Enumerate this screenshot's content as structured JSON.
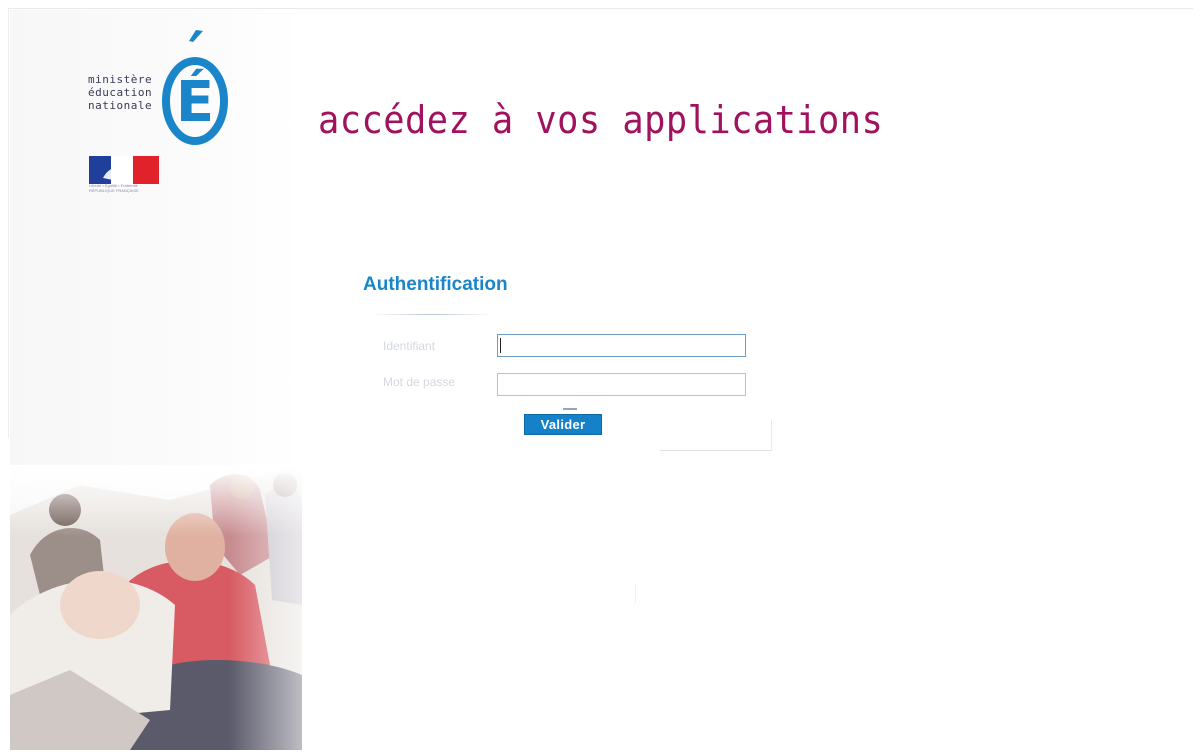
{
  "logo": {
    "ministry_lines": [
      "ministère",
      "éducation",
      "nationale"
    ],
    "emblem_letter": "É",
    "flag_caption_lines": [
      "Liberté • Égalité • Fraternité",
      "RÉPUBLIQUE FRANÇAISE"
    ]
  },
  "header": {
    "headline": "accédez à vos applications"
  },
  "auth": {
    "title": "Authentification",
    "identifier_label": "Identifiant",
    "password_label": "Mot de passe",
    "identifier_value": "",
    "password_value": "",
    "submit_label": "Valider"
  },
  "colors": {
    "headline": "#a0125e",
    "accent_blue": "#1a86c9",
    "button": "#1581c9"
  }
}
